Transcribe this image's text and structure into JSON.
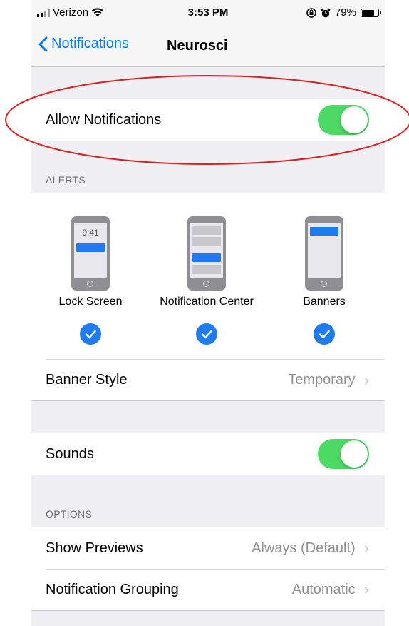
{
  "status_bar": {
    "carrier": "Verizon",
    "time": "3:53 PM",
    "battery": "79%",
    "battery_level": 0.79
  },
  "nav": {
    "back_label": "Notifications",
    "title": "Neurosci"
  },
  "allow_notifications": {
    "label": "Allow Notifications",
    "on": true
  },
  "alerts": {
    "header": "ALERTS",
    "options": [
      {
        "label": "Lock Screen",
        "clock": "9:41",
        "checked": true
      },
      {
        "label": "Notification Center",
        "checked": true
      },
      {
        "label": "Banners",
        "checked": true
      }
    ],
    "banner_style": {
      "label": "Banner Style",
      "value": "Temporary"
    }
  },
  "sounds": {
    "label": "Sounds",
    "on": true
  },
  "options": {
    "header": "OPTIONS",
    "rows": [
      {
        "label": "Show Previews",
        "value": "Always (Default)"
      },
      {
        "label": "Notification Grouping",
        "value": "Automatic"
      }
    ]
  },
  "colors": {
    "accent": "#007aff",
    "toggle_on": "#4cd964",
    "annotation": "#e01e1e"
  },
  "icons": [
    "signal-icon",
    "wifi-icon",
    "rotation-lock-icon",
    "alarm-icon",
    "battery-icon",
    "back-chevron-icon",
    "checkmark-icon",
    "chevron-right-icon"
  ]
}
